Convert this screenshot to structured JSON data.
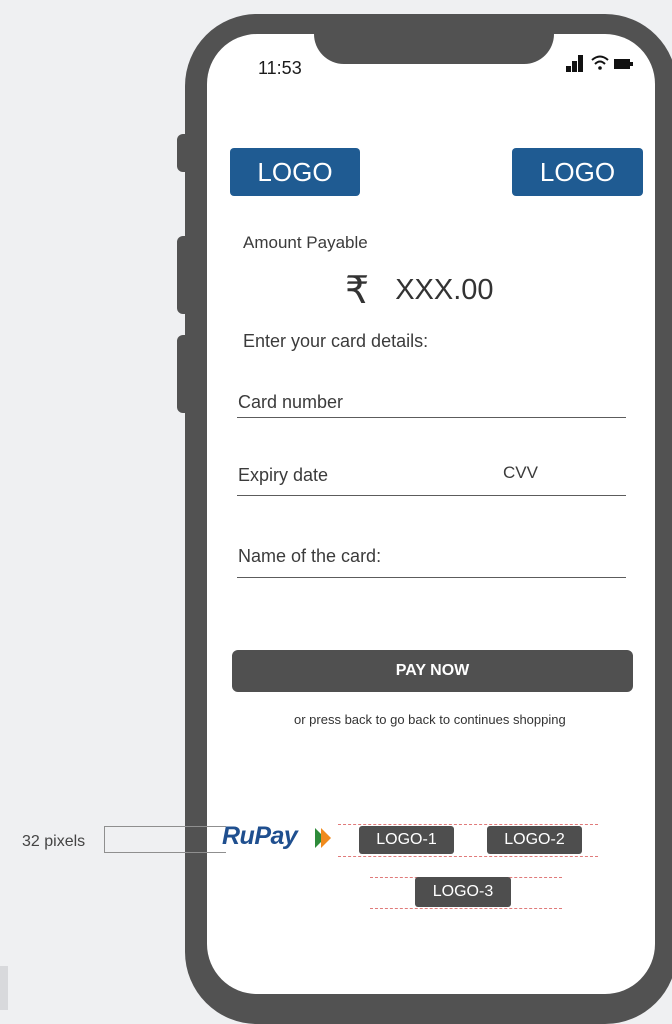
{
  "status_bar": {
    "time": "11:53",
    "icons": [
      "signal-icon",
      "wifi-icon",
      "battery-icon"
    ]
  },
  "header": {
    "logo_left": "LOGO",
    "logo_right": "LOGO"
  },
  "payment": {
    "amount_label": "Amount Payable",
    "currency_symbol": "₹",
    "amount": "XXX.00",
    "card_details_label": "Enter your card details:",
    "card_number_placeholder": "Card number",
    "expiry_placeholder": "Expiry date",
    "cvv_placeholder": "CVV",
    "card_name_placeholder": "Name of the card:"
  },
  "actions": {
    "pay_label": "PAY NOW",
    "hint": "or press back to go back to continues shopping"
  },
  "footer_logos": {
    "rupay": "RuPay",
    "logo1": "LOGO-1",
    "logo2": "LOGO-2",
    "logo3": "LOGO-3"
  },
  "annotation": {
    "spacing_label": "32 pixels"
  },
  "colors": {
    "logo_bg": "#1f5b92",
    "button_bg": "#505050",
    "phone_frame": "#525252",
    "guide_dash": "#e07a7a"
  }
}
